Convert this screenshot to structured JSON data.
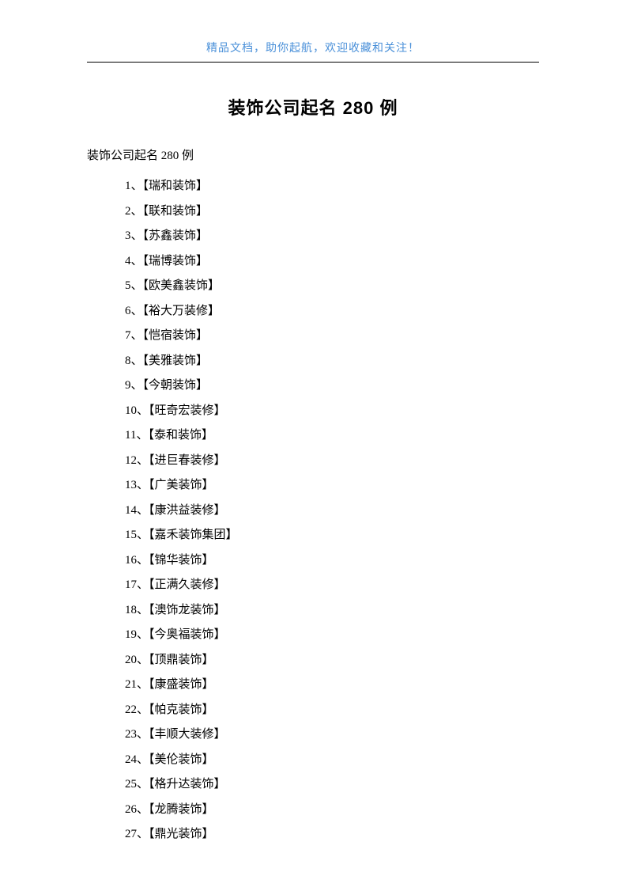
{
  "header": {
    "note": "精品文档，助你起航，欢迎收藏和关注！"
  },
  "title": "装饰公司起名 280 例",
  "intro": "装饰公司起名 280 例",
  "items": [
    "1、【瑞和装饰】",
    "2、【联和装饰】",
    "3、【苏鑫装饰】",
    "4、【瑞博装饰】",
    "5、【欧美鑫装饰】",
    "6、【裕大万装修】",
    "7、【恺宿装饰】",
    "8、【美雅装饰】",
    "9、【今朝装饰】",
    "10、【旺奇宏装修】",
    "11、【泰和装饰】",
    "12、【进巨春装修】",
    "13、【广美装饰】",
    "14、【康洪益装修】",
    "15、【嘉禾装饰集团】",
    "16、【锦华装饰】",
    "17、【正满久装修】",
    "18、【澳饰龙装饰】",
    "19、【今奥福装饰】",
    "20、【顶鼎装饰】",
    "21、【康盛装饰】",
    "22、【帕克装饰】",
    "23、【丰顺大装修】",
    "24、【美伦装饰】",
    "25、【格升达装饰】",
    "26、【龙腾装饰】",
    "27、【鼎光装饰】"
  ]
}
